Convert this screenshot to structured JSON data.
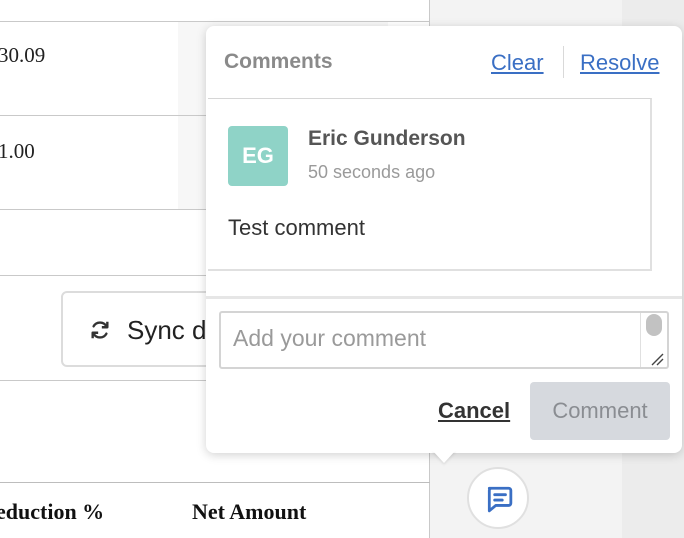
{
  "background_table": {
    "rows": [
      {
        "value": "30.09"
      },
      {
        "value": "1.00"
      }
    ],
    "sync_button": {
      "label": "Sync d",
      "icon": "sync-icon"
    },
    "headers": [
      "eduction %",
      "Net Amount"
    ]
  },
  "comments_panel": {
    "title": "Comments",
    "clear_label": "Clear",
    "resolve_label": "Resolve",
    "comment": {
      "avatar_initials": "EG",
      "avatar_color": "#8fd3c7",
      "author": "Eric Gunderson",
      "time": "50 seconds ago",
      "text": "Test comment"
    },
    "input": {
      "placeholder": "Add your comment",
      "value": ""
    },
    "cancel_label": "Cancel",
    "submit_label": "Comment",
    "toggle_icon": "comment-bubble-icon",
    "accent_color": "#3a6fc4"
  }
}
